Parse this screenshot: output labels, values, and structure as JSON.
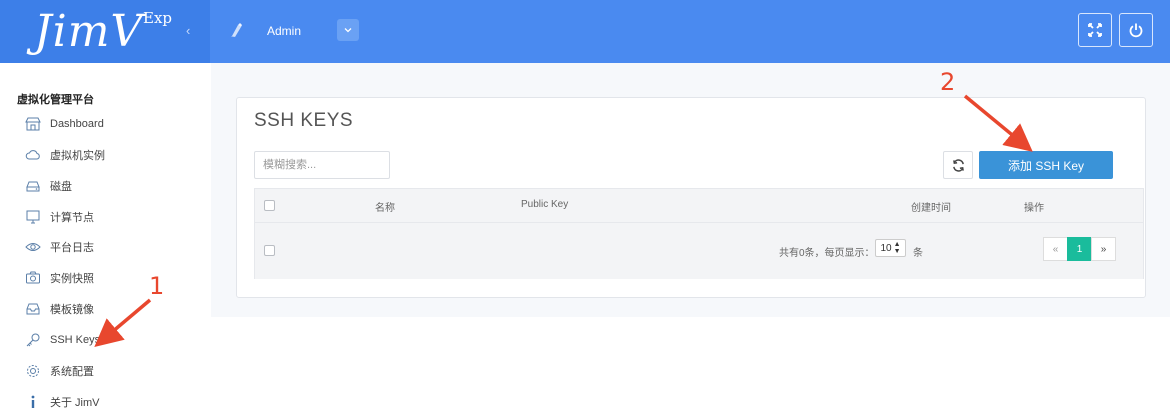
{
  "header": {
    "logo": "JimV",
    "logo_suffix": "Exp",
    "collapse_icon": "chevron-left-icon",
    "user_name": "Admin",
    "user_dropdown_icon": "chevron-down-icon",
    "fullscreen_icon": "fullscreen-icon",
    "power_icon": "power-icon",
    "background": "#4a8af0"
  },
  "sidebar": {
    "title": "虚拟化管理平台",
    "items": [
      {
        "label": "Dashboard",
        "icon": "store-icon"
      },
      {
        "label": "虚拟机实例",
        "icon": "cloud-icon"
      },
      {
        "label": "磁盘",
        "icon": "hdd-icon"
      },
      {
        "label": "计算节点",
        "icon": "monitor-icon"
      },
      {
        "label": "平台日志",
        "icon": "eye-icon"
      },
      {
        "label": "实例快照",
        "icon": "camera-icon"
      },
      {
        "label": "模板镜像",
        "icon": "inbox-icon"
      },
      {
        "label": "SSH Keys",
        "icon": "key-icon"
      },
      {
        "label": "系统配置",
        "icon": "gear-icon"
      },
      {
        "label": "关于 JimV",
        "icon": "info-icon"
      }
    ]
  },
  "main": {
    "title": "SSH KEYS",
    "search_placeholder": "模糊搜索...",
    "refresh_icon": "refresh-icon",
    "add_button": "添加 SSH Key",
    "accent": "#3a93d8",
    "table": {
      "columns": [
        "名称",
        "Public Key",
        "创建时间",
        "操作"
      ],
      "rows": []
    },
    "footer": {
      "total_text": "共有0条，每页显示：",
      "page_size": "10",
      "page_size_unit": "条"
    },
    "pagination": {
      "prev": "«",
      "current": "1",
      "next": "»",
      "active_color": "#1abc9c"
    }
  },
  "annotations": {
    "step1": "1",
    "step2": "2",
    "color": "#e8472e"
  }
}
